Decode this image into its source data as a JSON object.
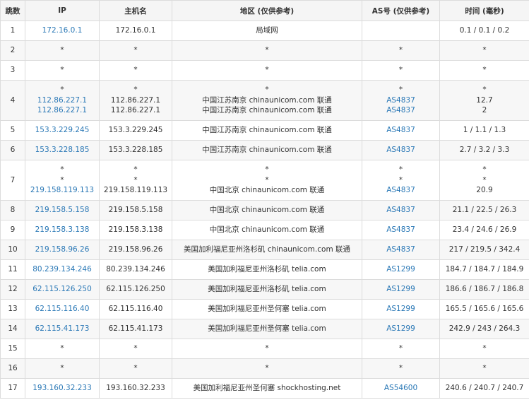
{
  "headers": [
    "跳数",
    "IP",
    "主机名",
    "地区 (仅供参考)",
    "AS号 (仅供参考)",
    "时间 (毫秒)"
  ],
  "rows": [
    {
      "hop": "1",
      "lines": [
        {
          "ip": "172.16.0.1",
          "host": "172.16.0.1",
          "region": "局域网",
          "as": "",
          "time": "0.1 / 0.1 / 0.2"
        }
      ]
    },
    {
      "hop": "2",
      "lines": [
        {
          "ip": "*",
          "host": "*",
          "region": "*",
          "as": "*",
          "time": "*"
        }
      ]
    },
    {
      "hop": "3",
      "lines": [
        {
          "ip": "*",
          "host": "*",
          "region": "*",
          "as": "*",
          "time": "*"
        }
      ]
    },
    {
      "hop": "4",
      "lines": [
        {
          "ip": "*",
          "host": "*",
          "region": "*",
          "as": "*",
          "time": "*"
        },
        {
          "ip": "112.86.227.1",
          "host": "112.86.227.1",
          "region": "中国江苏南京 chinaunicom.com 联通",
          "as": "AS4837",
          "time": "12.7"
        },
        {
          "ip": "112.86.227.1",
          "host": "112.86.227.1",
          "region": "中国江苏南京 chinaunicom.com 联通",
          "as": "AS4837",
          "time": "2"
        }
      ]
    },
    {
      "hop": "5",
      "lines": [
        {
          "ip": "153.3.229.245",
          "host": "153.3.229.245",
          "region": "中国江苏南京 chinaunicom.com 联通",
          "as": "AS4837",
          "time": "1 / 1.1 / 1.3"
        }
      ]
    },
    {
      "hop": "6",
      "lines": [
        {
          "ip": "153.3.228.185",
          "host": "153.3.228.185",
          "region": "中国江苏南京 chinaunicom.com 联通",
          "as": "AS4837",
          "time": "2.7 / 3.2 / 3.3"
        }
      ]
    },
    {
      "hop": "7",
      "lines": [
        {
          "ip": "*",
          "host": "*",
          "region": "*",
          "as": "*",
          "time": "*"
        },
        {
          "ip": "*",
          "host": "*",
          "region": "*",
          "as": "*",
          "time": "*"
        },
        {
          "ip": "219.158.119.113",
          "host": "219.158.119.113",
          "region": "中国北京 chinaunicom.com 联通",
          "as": "AS4837",
          "time": "20.9"
        }
      ]
    },
    {
      "hop": "8",
      "lines": [
        {
          "ip": "219.158.5.158",
          "host": "219.158.5.158",
          "region": "中国北京 chinaunicom.com 联通",
          "as": "AS4837",
          "time": "21.1 / 22.5 / 26.3"
        }
      ]
    },
    {
      "hop": "9",
      "lines": [
        {
          "ip": "219.158.3.138",
          "host": "219.158.3.138",
          "region": "中国北京 chinaunicom.com 联通",
          "as": "AS4837",
          "time": "23.4 / 24.6 / 26.9"
        }
      ]
    },
    {
      "hop": "10",
      "lines": [
        {
          "ip": "219.158.96.26",
          "host": "219.158.96.26",
          "region": "美国加利福尼亚州洛杉矶 chinaunicom.com 联通",
          "as": "AS4837",
          "time": "217 / 219.5 / 342.4"
        }
      ]
    },
    {
      "hop": "11",
      "lines": [
        {
          "ip": "80.239.134.246",
          "host": "80.239.134.246",
          "region": "美国加利福尼亚州洛杉矶 telia.com",
          "as": "AS1299",
          "time": "184.7 / 184.7 / 184.9"
        }
      ]
    },
    {
      "hop": "12",
      "lines": [
        {
          "ip": "62.115.126.250",
          "host": "62.115.126.250",
          "region": "美国加利福尼亚州洛杉矶 telia.com",
          "as": "AS1299",
          "time": "186.6 / 186.7 / 186.8"
        }
      ]
    },
    {
      "hop": "13",
      "lines": [
        {
          "ip": "62.115.116.40",
          "host": "62.115.116.40",
          "region": "美国加利福尼亚州圣何塞 telia.com",
          "as": "AS1299",
          "time": "165.5 / 165.6 / 165.6"
        }
      ]
    },
    {
      "hop": "14",
      "lines": [
        {
          "ip": "62.115.41.173",
          "host": "62.115.41.173",
          "region": "美国加利福尼亚州圣何塞 telia.com",
          "as": "AS1299",
          "time": "242.9 / 243 / 264.3"
        }
      ]
    },
    {
      "hop": "15",
      "lines": [
        {
          "ip": "*",
          "host": "*",
          "region": "*",
          "as": "*",
          "time": "*"
        }
      ]
    },
    {
      "hop": "16",
      "lines": [
        {
          "ip": "*",
          "host": "*",
          "region": "*",
          "as": "*",
          "time": "*"
        }
      ]
    },
    {
      "hop": "17",
      "lines": [
        {
          "ip": "193.160.32.233",
          "host": "193.160.32.233",
          "region": "美国加利福尼亚州圣何塞 shockhosting.net",
          "as": "AS54600",
          "time": "240.6 / 240.7 / 240.7"
        }
      ]
    }
  ],
  "colors": {
    "link": "#2a78b6",
    "header_bg": "#f5f5f5",
    "stripe": "#f7f7f7",
    "border": "#dcdcdc"
  }
}
